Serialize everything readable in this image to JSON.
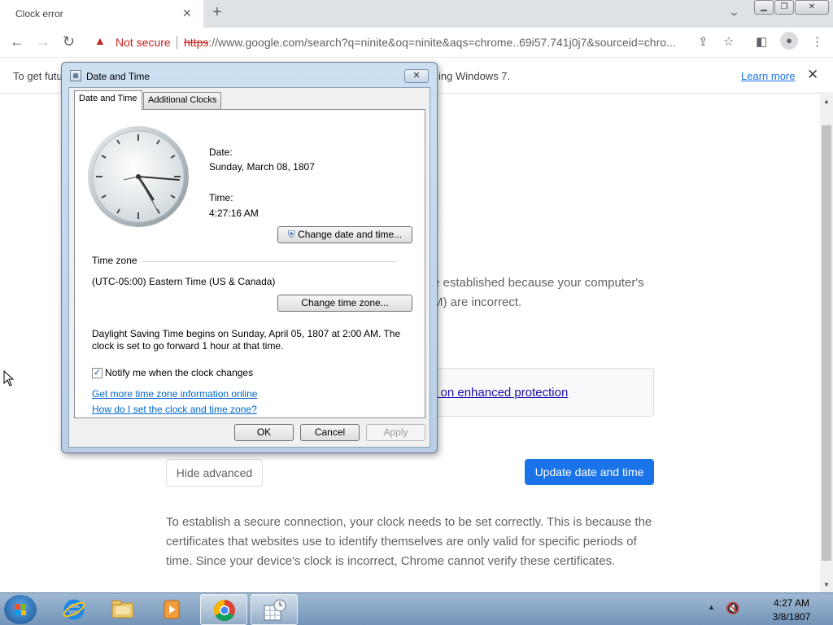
{
  "browser": {
    "tab_title": "Clock error",
    "tab_close": "✕",
    "new_tab": "+",
    "omnibox": {
      "security_label": "Not secure",
      "url_scheme": "https",
      "url_rest": "://www.google.com/search?q=ninite&oq=ninite&aqs=chrome..69i57.741j0j7&sourceid=chro..."
    },
    "infobar": {
      "text_left": "To get futu",
      "text_right": "ing Windows 7.",
      "learn_more": "Learn more"
    }
  },
  "page": {
    "para1_line1": "e established because your computer's",
    "para1_line2": "M) are incorrect.",
    "enhanced_link": "rn on enhanced protection",
    "hide_advanced": "Hide advanced",
    "update_button": "Update date and time",
    "para2": [
      "To establish a secure connection, your clock needs to be set correctly. This is because the",
      "certificates that websites use to identify themselves are only valid for specific periods of",
      "time. Since your device's clock is incorrect, Chrome cannot verify these certificates."
    ]
  },
  "dialog": {
    "title": "Date and Time",
    "tabs": [
      "Date and Time",
      "Additional Clocks"
    ],
    "date_label": "Date:",
    "date_value": "Sunday, March 08, 1807",
    "time_label": "Time:",
    "time_value": "4:27:16 AM",
    "change_datetime": "Change date and time...",
    "timezone_heading": "Time zone",
    "timezone_value": "(UTC-05:00) Eastern Time (US & Canada)",
    "change_timezone": "Change time zone...",
    "dst_line1": "Daylight Saving Time begins on Sunday, April 05, 1807 at 2:00 AM. The",
    "dst_line2": "clock is set to go forward 1 hour at that time.",
    "notify_label": "Notify me when the clock changes",
    "notify_checked": true,
    "link1": "Get more time zone information online",
    "link2": "How do I set the clock and time zone?",
    "ok": "OK",
    "cancel": "Cancel",
    "apply": "Apply"
  },
  "taskbar": {
    "time": "4:27 AM",
    "date": "3/8/1807",
    "apps": [
      "internet-explorer",
      "windows-explorer",
      "media-player",
      "chrome",
      "date-and-time"
    ]
  }
}
